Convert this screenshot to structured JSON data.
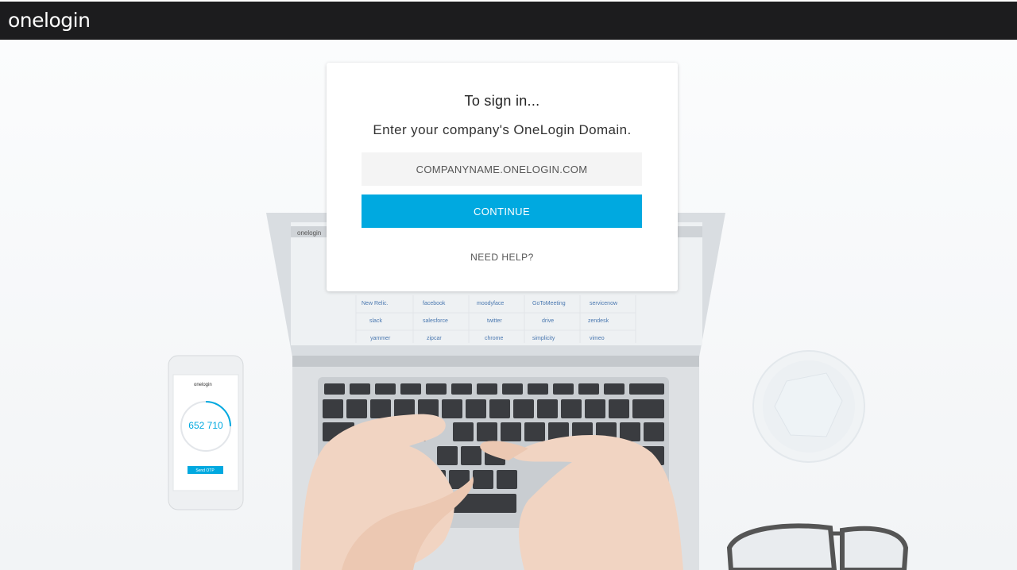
{
  "header": {
    "logo_text": "onelogin"
  },
  "login": {
    "title": "To sign in...",
    "subtitle": "Enter your company's OneLogin Domain.",
    "domain_placeholder": "COMPANYNAME.ONELOGIN.COM",
    "domain_value": "",
    "continue_label": "CONTINUE",
    "help_label": "NEED HELP?"
  },
  "background": {
    "screen_apps": [
      "New Relic.",
      "facebook",
      "moodyface",
      "GoToMeeting",
      "servicenow",
      "slack",
      "salesforce",
      "twitter",
      "drive",
      "zendesk",
      "yammer",
      "zipcar",
      "chrome",
      "simplicity",
      "vimeo"
    ],
    "screen_header": "onelogin",
    "phone_brand": "onelogin",
    "phone_otp": "652 710",
    "phone_button": "Send OTP"
  },
  "colors": {
    "accent": "#00a9e0",
    "topbar": "#1c1c1e",
    "input_bg": "#f4f4f4"
  }
}
